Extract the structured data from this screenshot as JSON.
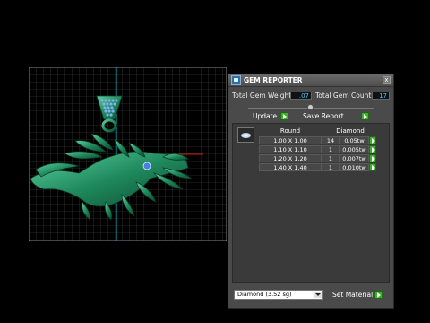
{
  "window": {
    "title": "GEM REPORTER",
    "close_glyph": "x"
  },
  "summary": {
    "weight_label": "Total Gem Weight",
    "weight_value": ".07",
    "count_label": "Total Gem Count",
    "count_value": "17"
  },
  "actions": {
    "update_label": "Update",
    "save_label": "Save Report"
  },
  "gem_table": {
    "headers": [
      "Round",
      "Diamond"
    ],
    "rows": [
      {
        "size": "1.00 X 1.00",
        "count": "14",
        "weight": "0.05tw"
      },
      {
        "size": "1.10 X 1.10",
        "count": "1",
        "weight": "0.005tw"
      },
      {
        "size": "1.20 X 1.20",
        "count": "1",
        "weight": "0.007tw"
      },
      {
        "size": "1.40 X 1.40",
        "count": "1",
        "weight": "0.010tw"
      }
    ]
  },
  "material": {
    "selected": "Diamond     (3.52 sg)",
    "set_label": "Set Material"
  },
  "colors": {
    "model": "#1f8a5e",
    "gem": "#4a7fe0",
    "grid": "#555555",
    "axis_y": "#18b4c4",
    "axis_x": "#c41818",
    "value_text": "#45c8ff",
    "go_button": "#3fae2a"
  },
  "icons": {
    "app": "gem-reporter-app-icon",
    "close": "close-icon",
    "go": "green-arrow-icon",
    "gem": "round-diamond-icon",
    "dropdown": "chevron-down-icon"
  }
}
